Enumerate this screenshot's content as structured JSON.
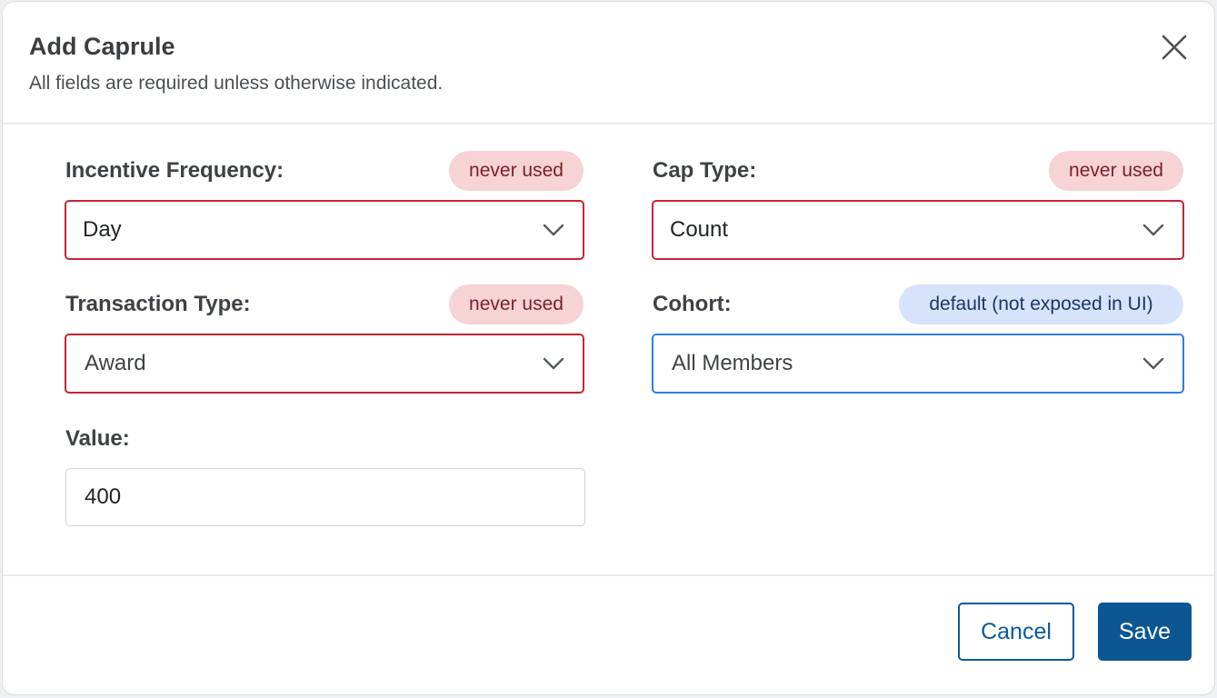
{
  "dialog": {
    "title": "Add Caprule",
    "subtitle": "All fields are required unless otherwise indicated.",
    "close_icon": "close-icon"
  },
  "fields": {
    "incentive_frequency": {
      "label": "Incentive Frequency:",
      "badge": "never used",
      "value": "Day"
    },
    "cap_type": {
      "label": "Cap Type:",
      "badge": "never used",
      "value": "Count"
    },
    "transaction_type": {
      "label": "Transaction Type:",
      "badge": "never used",
      "value": "Award"
    },
    "cohort": {
      "label": "Cohort:",
      "badge": "default (not exposed in UI)",
      "value": "All Members"
    },
    "value": {
      "label": "Value:",
      "value": "400"
    }
  },
  "footer": {
    "cancel_label": "Cancel",
    "save_label": "Save"
  },
  "colors": {
    "error_border": "#c82333",
    "focus_border": "#2f7de1",
    "primary": "#0b5794",
    "badge_red_bg": "#f6d3d5",
    "badge_blue_bg": "#d7e3fb"
  }
}
